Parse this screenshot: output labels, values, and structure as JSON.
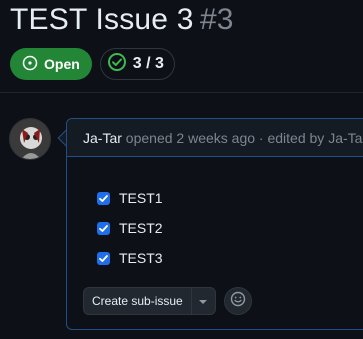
{
  "issue": {
    "title": "TEST Issue 3",
    "number": "#3",
    "state": "Open",
    "sub_issue_progress": "3 / 3"
  },
  "comment": {
    "author": "Ja-Tar",
    "action": "opened",
    "time": "2 weeks ago",
    "separator": "·",
    "edited_label": "edited by",
    "editor": "Ja-Tar",
    "tasks": [
      {
        "label": "TEST1",
        "checked": true
      },
      {
        "label": "TEST2",
        "checked": true
      },
      {
        "label": "TEST3",
        "checked": true
      }
    ],
    "create_sub_issue_label": "Create sub-issue"
  },
  "colors": {
    "open_badge": "#238636",
    "checkbox": "#1f6feb",
    "comment_border": "#1f4f86"
  },
  "icons": {
    "state": "issue-opened-icon",
    "progress": "check-circle-icon",
    "dropdown": "triangle-down-icon",
    "reaction": "smiley-icon"
  }
}
